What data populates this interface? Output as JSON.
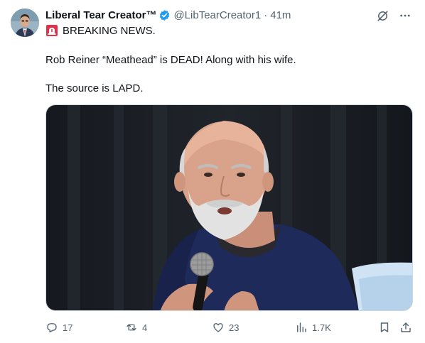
{
  "tweet": {
    "author": "Liberal Tear Creator™",
    "handle": "@LibTearCreator1",
    "separator": "·",
    "time": "41m",
    "line1": "BREAKING NEWS.",
    "line2": "Rob Reiner “Meathead” is DEAD! Along with his wife.",
    "line3": "The source is LAPD."
  },
  "metrics": {
    "replies": "17",
    "reposts": "4",
    "likes": "23",
    "views": "1.7K"
  },
  "icons": {
    "verified": "verified-badge-icon",
    "grok": "grok-icon",
    "more": "more-icon",
    "siren": "siren-emoji-icon",
    "reply": "reply-icon",
    "repost": "repost-icon",
    "like": "heart-icon",
    "views": "views-icon",
    "bookmark": "bookmark-icon",
    "share": "share-icon"
  },
  "colors": {
    "text": "#0f1419",
    "secondary": "#536471",
    "verified": "#1d9bf0"
  }
}
